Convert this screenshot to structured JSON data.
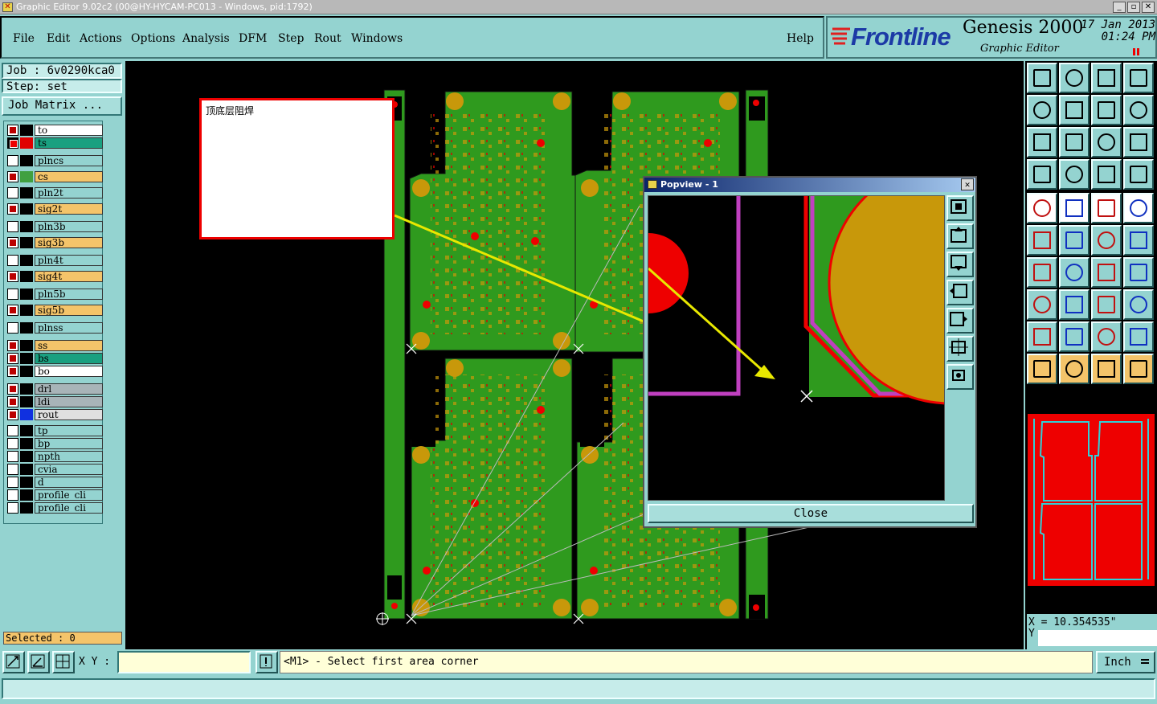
{
  "window": {
    "title": "Graphic Editor 9.02c2 (00@HY-HYCAM-PC013 - Windows, pid:1792)",
    "buttons": [
      "_",
      "▫",
      "✕"
    ]
  },
  "menu": {
    "items": [
      "File",
      "Edit",
      "Actions",
      "Options",
      "Analysis",
      "DFM",
      "Step",
      "Rout",
      "Windows"
    ],
    "help": "Help"
  },
  "brand": {
    "logo": "Frontline",
    "product": "Genesis 2000",
    "subtitle": "Graphic Editor",
    "date": "17 Jan 2013",
    "time": "01:24 PM"
  },
  "job": {
    "job_label": "Job : 6v0290kca0",
    "step_label": "Step: set",
    "matrix_button": "Job Matrix ..."
  },
  "layers": [
    {
      "name": "to",
      "state": "checked",
      "color": "#ffffff",
      "swatch": "#000000"
    },
    {
      "name": "ts",
      "state": "work",
      "color": "#1aa080",
      "swatch": "#e00000"
    },
    {
      "name": "plncs",
      "state": "off",
      "color": "#94d3d0",
      "swatch": "#000000"
    },
    {
      "name": "cs",
      "state": "checked",
      "color": "#f4c46a",
      "swatch": "#40a040"
    },
    {
      "name": "pln2t",
      "state": "off",
      "color": "#94d3d0",
      "swatch": "#000000"
    },
    {
      "name": "sig2t",
      "state": "checked",
      "color": "#f4c46a",
      "swatch": "#000000"
    },
    {
      "name": "pln3b",
      "state": "off",
      "color": "#94d3d0",
      "swatch": "#000000"
    },
    {
      "name": "sig3b",
      "state": "checked",
      "color": "#f4c46a",
      "swatch": "#000000"
    },
    {
      "name": "pln4t",
      "state": "off",
      "color": "#94d3d0",
      "swatch": "#000000"
    },
    {
      "name": "sig4t",
      "state": "checked",
      "color": "#f4c46a",
      "swatch": "#000000"
    },
    {
      "name": "pln5b",
      "state": "off",
      "color": "#94d3d0",
      "swatch": "#000000"
    },
    {
      "name": "sig5b",
      "state": "checked",
      "color": "#f4c46a",
      "swatch": "#000000"
    },
    {
      "name": "plnss",
      "state": "off",
      "color": "#94d3d0",
      "swatch": "#000000"
    },
    {
      "name": "ss",
      "state": "checked",
      "color": "#f4c46a",
      "swatch": "#000000"
    },
    {
      "name": "bs",
      "state": "checked",
      "color": "#1aa080",
      "swatch": "#000000"
    },
    {
      "name": "bo",
      "state": "checked",
      "color": "#ffffff",
      "swatch": "#000000"
    },
    {
      "name": "drl",
      "state": "checked",
      "color": "#a8b4b8",
      "swatch": "#000000"
    },
    {
      "name": "ldi",
      "state": "checked",
      "color": "#a8b4b8",
      "swatch": "#000000"
    },
    {
      "name": "rout",
      "state": "checked",
      "color": "#e0e0e0",
      "swatch": "#1030e0"
    },
    {
      "name": "tp",
      "state": "off",
      "color": "#94d3d0",
      "swatch": "#000000"
    },
    {
      "name": "bp",
      "state": "off",
      "color": "#94d3d0",
      "swatch": "#000000"
    },
    {
      "name": "npth",
      "state": "off",
      "color": "#94d3d0",
      "swatch": "#000000"
    },
    {
      "name": "cvia",
      "state": "off",
      "color": "#94d3d0",
      "swatch": "#000000"
    },
    {
      "name": "d",
      "state": "off",
      "color": "#94d3d0",
      "swatch": "#000000"
    },
    {
      "name": "profile_cli",
      "state": "off",
      "color": "#94d3d0",
      "swatch": "#000000"
    },
    {
      "name": "profile_cli",
      "state": "off",
      "color": "#94d3d0",
      "swatch": "#000000"
    }
  ],
  "selected": "Selected : 0",
  "note": {
    "text": "顶底层阻焊"
  },
  "popview": {
    "title": "Popview - 1",
    "close_label": "Close"
  },
  "coords": {
    "x": "X = 10.354535\"",
    "y": "Y"
  },
  "status": {
    "xy_label": "X Y :",
    "xy_value": "",
    "message": "<M1> - Select first area corner",
    "unit": "Inch"
  },
  "colors": {
    "board": "#2f9a1e",
    "pad": "#c8980a",
    "mask": "#e00000",
    "profile": "#c040c0",
    "highlight": "#e8e800"
  }
}
